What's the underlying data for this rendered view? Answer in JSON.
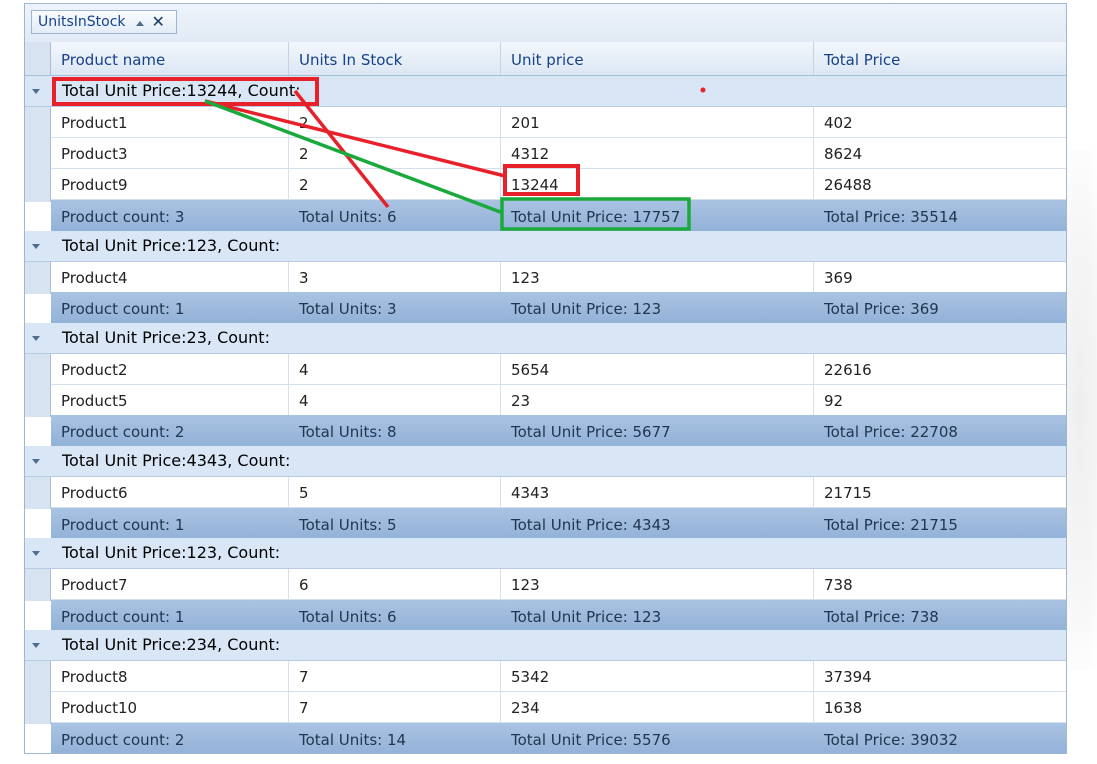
{
  "group_panel": {
    "chip_label": "UnitsInStock"
  },
  "columns": [
    "Product name",
    "Units In Stock",
    "Unit price",
    "Total Price"
  ],
  "groups": [
    {
      "header": "Total Unit Price:13244, Count:",
      "rows": [
        [
          "Product1",
          "2",
          "201",
          "402"
        ],
        [
          "Product3",
          "2",
          "4312",
          "8624"
        ],
        [
          "Product9",
          "2",
          "13244",
          "26488"
        ]
      ],
      "footer": [
        "Product count: 3",
        "Total Units: 6",
        "Total Unit Price: 17757",
        "Total Price: 35514"
      ]
    },
    {
      "header": "Total Unit Price:123, Count:",
      "rows": [
        [
          "Product4",
          "3",
          "123",
          "369"
        ]
      ],
      "footer": [
        "Product count: 1",
        "Total Units: 3",
        "Total Unit Price: 123",
        "Total Price: 369"
      ]
    },
    {
      "header": "Total Unit Price:23, Count:",
      "rows": [
        [
          "Product2",
          "4",
          "5654",
          "22616"
        ],
        [
          "Product5",
          "4",
          "23",
          "92"
        ]
      ],
      "footer": [
        "Product count: 2",
        "Total Units: 8",
        "Total Unit Price: 5677",
        "Total Price: 22708"
      ]
    },
    {
      "header": "Total Unit Price:4343, Count:",
      "rows": [
        [
          "Product6",
          "5",
          "4343",
          "21715"
        ]
      ],
      "footer": [
        "Product count: 1",
        "Total Units: 5",
        "Total Unit Price: 4343",
        "Total Price: 21715"
      ]
    },
    {
      "header": "Total Unit Price:123, Count:",
      "rows": [
        [
          "Product7",
          "6",
          "123",
          "738"
        ]
      ],
      "footer": [
        "Product count: 1",
        "Total Units: 6",
        "Total Unit Price: 123",
        "Total Price: 738"
      ]
    },
    {
      "header": "Total Unit Price:234, Count:",
      "rows": [
        [
          "Product8",
          "7",
          "5342",
          "37394"
        ],
        [
          "Product10",
          "7",
          "234",
          "1638"
        ]
      ],
      "footer": [
        "Product count: 2",
        "Total Units: 14",
        "Total Unit Price: 5576",
        "Total Price: 39032"
      ]
    }
  ],
  "annotation_colors": {
    "red": "#e8202a",
    "green": "#1aaa3c"
  }
}
